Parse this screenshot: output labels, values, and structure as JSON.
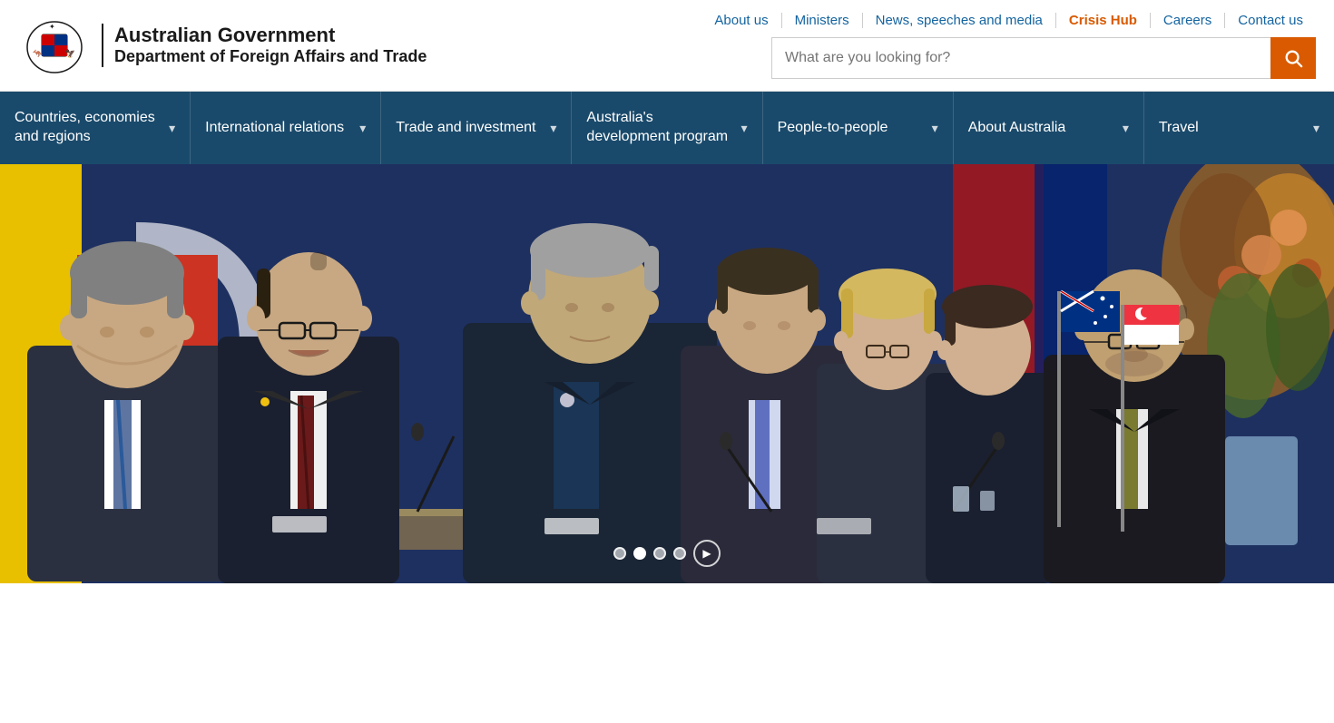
{
  "header": {
    "logo": {
      "title": "Australian Government",
      "subtitle": "Department of Foreign Affairs and Trade"
    },
    "top_nav": [
      {
        "label": "About us",
        "href": "#"
      },
      {
        "label": "Ministers",
        "href": "#"
      },
      {
        "label": "News, speeches and media",
        "href": "#"
      },
      {
        "label": "Crisis Hub",
        "href": "#"
      },
      {
        "label": "Careers",
        "href": "#"
      },
      {
        "label": "Contact us",
        "href": "#"
      }
    ],
    "search": {
      "placeholder": "What are you looking for?",
      "button_label": "Search"
    }
  },
  "main_nav": [
    {
      "label": "Countries, economies and regions",
      "has_dropdown": true
    },
    {
      "label": "International relations",
      "has_dropdown": true
    },
    {
      "label": "Trade and investment",
      "has_dropdown": true
    },
    {
      "label": "Australia's development program",
      "has_dropdown": true
    },
    {
      "label": "People-to-people",
      "has_dropdown": true
    },
    {
      "label": "About Australia",
      "has_dropdown": true
    },
    {
      "label": "Travel",
      "has_dropdown": true
    }
  ],
  "carousel": {
    "dots": [
      {
        "active": false
      },
      {
        "active": true
      },
      {
        "active": false
      },
      {
        "active": false
      }
    ],
    "play_icon": "▶"
  },
  "icons": {
    "search": "🔍",
    "chevron_down": "▾",
    "play": "▶"
  }
}
